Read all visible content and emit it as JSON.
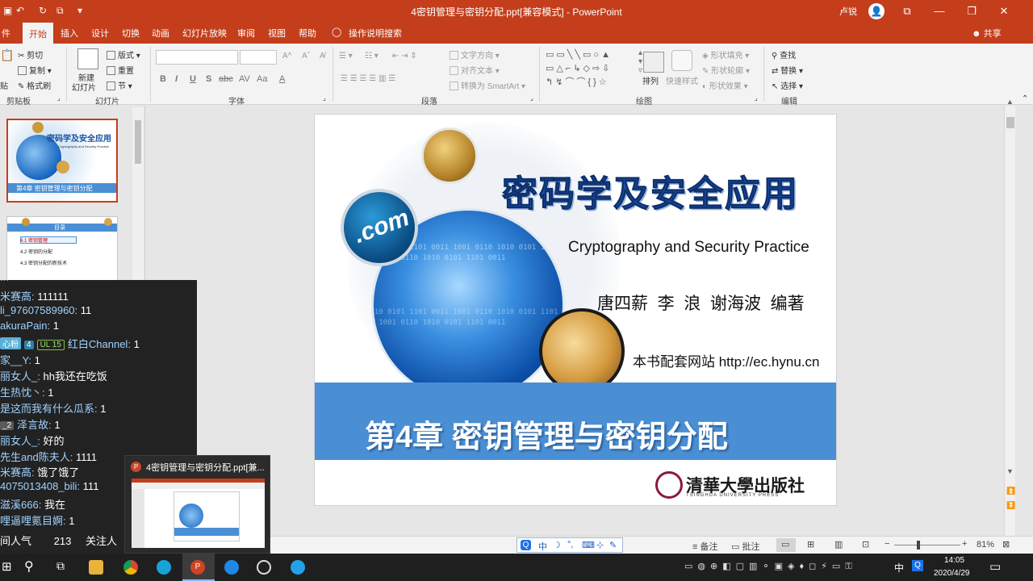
{
  "window": {
    "title": "4密钥管理与密钥分配.ppt[兼容模式] - PowerPoint",
    "user": "卢锐",
    "avatar_glyph": "👤",
    "controls": {
      "ribbon_display": "⧉",
      "minimize": "—",
      "restore": "❐",
      "close": "✕"
    },
    "quick_access": {
      "save": "▣",
      "undo": "↶",
      "redo": "↻",
      "start": "⧉",
      "more": "▾"
    }
  },
  "tabs": [
    "件",
    "开始",
    "插入",
    "设计",
    "切换",
    "动画",
    "幻灯片放映",
    "审阅",
    "视图",
    "帮助"
  ],
  "active_tab": "开始",
  "tell_me": "操作说明搜索",
  "share": "共享",
  "ribbon": {
    "clipboard": {
      "cut": "剪切",
      "copy": "复制",
      "format_painter": "格式刷",
      "paste_fragment": "贴",
      "label": "剪贴板"
    },
    "slides": {
      "new_slide": "新建",
      "new_slide2": "幻灯片",
      "layout": "版式",
      "reset": "重置",
      "section": "节",
      "label": "幻灯片"
    },
    "font": {
      "label": "字体",
      "buttons": [
        "B",
        "I",
        "U",
        "S",
        "abc",
        "AV",
        "Aa",
        "A"
      ]
    },
    "paragraph": {
      "text_direction": "文字方向",
      "align_text": "对齐文本",
      "smartart": "转换为 SmartArt",
      "label": "段落"
    },
    "drawing": {
      "arrange": "排列",
      "quick_styles": "快速样式",
      "shape_fill": "形状填充",
      "shape_outline": "形状轮廓",
      "shape_effects": "形状效果",
      "label": "绘图"
    },
    "editing": {
      "find": "查找",
      "replace": "替换",
      "select": "选择",
      "label": "编辑"
    }
  },
  "thumbnails": [
    {
      "num": "",
      "title": "密码学及安全应用",
      "subtitle": "Cryptography and Security Practice",
      "chapter": "第4章 密钥管理与密钥分配"
    },
    {
      "num": "",
      "header": "目录",
      "items": [
        "4.1 密钥管理",
        "4.2 密钥的分配",
        "4.3 密钥分配的新技术"
      ]
    }
  ],
  "slide": {
    "title": "密码学及安全应用",
    "subtitle": "Cryptography and Security Practice",
    "authors": "唐四薪  李  浪  谢海波  编著",
    "website": "本书配套网站 http://ec.hynu.cn",
    "chapter": "第4章 密钥管理与密钥分配",
    "publisher": "清華大學出版社",
    "publisher_en": "TSINGHUA UNIVERSITY PRESS",
    "com_label": ".com",
    "binary": "1010 0101 1101 0011 1001 0110 1010 0101 1101 0011 1001 0110 1010 0101 1101 0011"
  },
  "statusbar": {
    "notes": "备注",
    "comments": "批注",
    "zoom": "81%",
    "ime": [
      "中",
      "☽",
      "°,",
      "⌨",
      "⊹",
      "✎"
    ]
  },
  "taskbar": {
    "time": "14:05",
    "date": "2020/4/29",
    "ime_lang": "中",
    "notify": "▭"
  },
  "danmaku": [
    {
      "user": "米赛高:",
      "text": "111111"
    },
    {
      "user": "li_97607589960:",
      "text": "11"
    },
    {
      "user": "akuraPain:",
      "text": "1"
    },
    {
      "pre": "心粉",
      "badge1": "4",
      "badge2": "UL 15",
      "user": "红白Channel:",
      "text": "1"
    },
    {
      "user": "家__Y:",
      "text": "1"
    },
    {
      "user": "丽女人_:",
      "text": "hh我还在吃饭"
    },
    {
      "user": "生热忱丶:",
      "text": "1"
    },
    {
      "user": "是这而我有什么瓜系:",
      "text": "1"
    },
    {
      "badge1": "_2",
      "user": "泽言故:",
      "text": "1"
    },
    {
      "user": "丽女人_:",
      "text": "好的"
    },
    {
      "user": "先生and陈夫人:",
      "text": "1111"
    },
    {
      "user": "米赛高:",
      "text": "饿了饿了"
    },
    {
      "user": "4075013408_bili:",
      "text": "111"
    },
    {
      "user": "滋溪666:",
      "text": "我在"
    },
    {
      "user": "哩逼哩氪目婀:",
      "text": "1"
    },
    {
      "user": "间人气",
      "text": "213",
      "extra": "关注人"
    }
  ],
  "danmaku_top": "...",
  "popup": {
    "title": "4密钥管理与密钥分配.ppt[兼..."
  }
}
